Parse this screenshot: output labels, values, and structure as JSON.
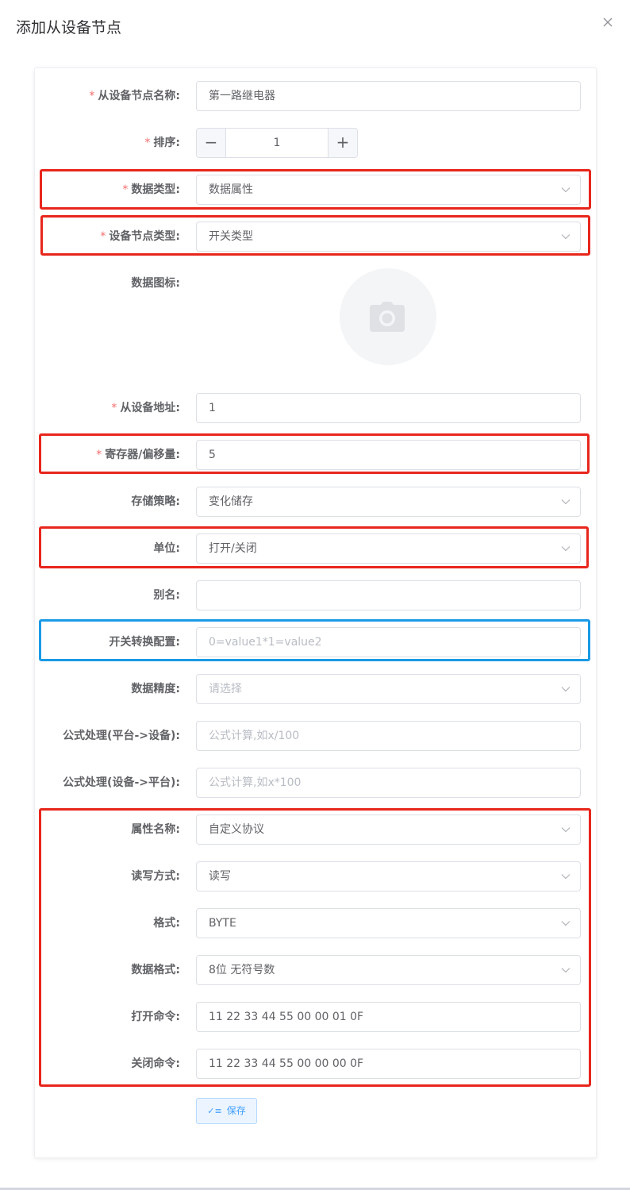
{
  "dialog": {
    "title": "添加从设备节点",
    "close_icon": "close-icon"
  },
  "form": {
    "node_name": {
      "label": "从设备节点名称:",
      "value": "第一路继电器",
      "required": true
    },
    "sort": {
      "label": "排序:",
      "value": "1",
      "minus": "−",
      "plus": "+",
      "required": true
    },
    "data_type": {
      "label": "数据类型:",
      "value": "数据属性",
      "required": true
    },
    "node_type": {
      "label": "设备节点类型:",
      "value": "开关类型",
      "required": true
    },
    "data_icon": {
      "label": "数据图标:",
      "icon": "camera-icon"
    },
    "slave_address": {
      "label": "从设备地址:",
      "value": "1",
      "required": true
    },
    "register_offset": {
      "label": "寄存器/偏移量:",
      "value": "5",
      "required": true
    },
    "storage_policy": {
      "label": "存储策略:",
      "value": "变化储存"
    },
    "unit": {
      "label": "单位:",
      "value": "打开/关闭"
    },
    "alias": {
      "label": "别名:",
      "value": ""
    },
    "switch_config": {
      "label": "开关转换配置:",
      "placeholder": "0=value1*1=value2"
    },
    "data_precision": {
      "label": "数据精度:",
      "placeholder": "请选择"
    },
    "formula_to_device": {
      "label": "公式处理(平台->设备):",
      "placeholder": "公式计算,如x/100"
    },
    "formula_to_platform": {
      "label": "公式处理(设备->平台):",
      "placeholder": "公式计算,如x*100"
    },
    "attribute_name": {
      "label": "属性名称:",
      "value": "自定义协议"
    },
    "read_write_mode": {
      "label": "读写方式:",
      "value": "读写"
    },
    "format": {
      "label": "格式:",
      "value": "BYTE"
    },
    "data_format": {
      "label": "数据格式:",
      "value": "8位 无符号数"
    },
    "open_command": {
      "label": "打开命令:",
      "value": "11 22 33 44 55 00 00 01 0F"
    },
    "close_command": {
      "label": "关闭命令:",
      "value": "11 22 33 44 55 00 00 00 0F"
    },
    "save_button": {
      "label": "保存",
      "icon": "check-icon"
    }
  },
  "colors": {
    "highlight_red": "#e8261c",
    "highlight_blue": "#1a9ae6",
    "required": "#f56c6c",
    "primary": "#409eff"
  }
}
